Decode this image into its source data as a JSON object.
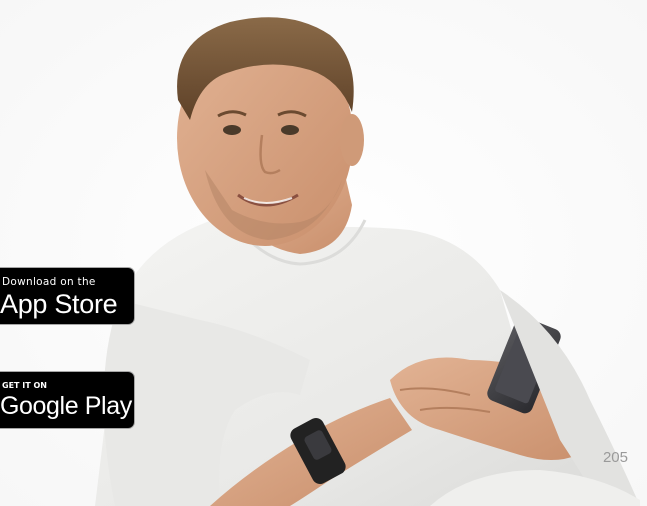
{
  "badges": {
    "app_store": {
      "line1": "Download on the",
      "line2": "App Store"
    },
    "google_play": {
      "line1": "GET IT ON",
      "line2": "Google Play"
    }
  },
  "page_number": "205",
  "colors": {
    "accent_green": "#7cc242",
    "badge_black": "#000000",
    "page_number_gray": "#9a9a9a",
    "shirt_white": "#f2f2f0",
    "skin": "#d9a886",
    "hair": "#7a5a3c",
    "watch_band": "#222222"
  },
  "image": {
    "subject": "man-with-smartphone-and-fitness-tracker-icon"
  }
}
